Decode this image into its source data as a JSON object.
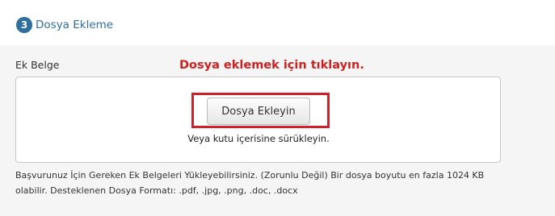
{
  "step": {
    "number": "3",
    "title": "Dosya Ekleme"
  },
  "attachment": {
    "label": "Ek Belge",
    "click_hint": "Dosya eklemek için tıklayın.",
    "add_button_label": "Dosya Ekleyin",
    "drag_hint": "Veya kutu içerisine sürükleyin.",
    "help_line1": "Başvurunuz İçin Gereken Ek Belgeleri Yükleyebilirsiniz. (Zorunlu Değil) Bir dosya boyutu en fazla 1024 KB",
    "help_line2": "olabilir. Desteklenen Dosya Formatı: .pdf, .jpg, .png, .doc, .docx"
  },
  "colors": {
    "accent": "#2f6f9f",
    "highlight": "#d0202a",
    "hint_text": "#cc2222",
    "panel_bg": "#f5f5f5"
  }
}
